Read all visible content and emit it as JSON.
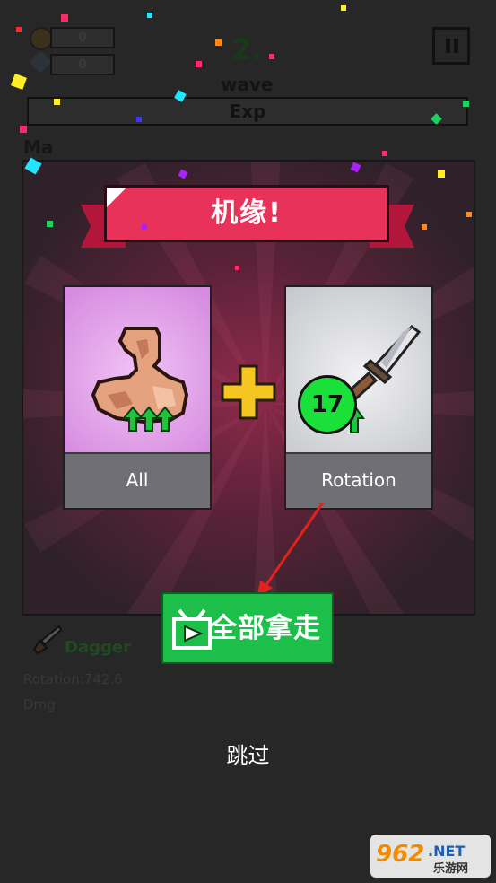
{
  "hud": {
    "coins": "0",
    "gems": "0",
    "wave_number": "2.",
    "wave_label": "wave",
    "exp_label": "Exp",
    "max_label": "Ma"
  },
  "popup": {
    "title": "机缘!",
    "left_card": {
      "label": "All",
      "icon": "muscle-arm-icon"
    },
    "right_card": {
      "label": "Rotation",
      "icon": "dagger-icon",
      "level": "17"
    },
    "take_all_label": "全部拿走",
    "skip_label": "跳过"
  },
  "weapon": {
    "name": "Dagger",
    "stat1": "Rotation:742.6",
    "stat2": "Dmg"
  },
  "watermark": {
    "number": "962",
    "suffix": ".NET",
    "site": "乐游网"
  },
  "colors": {
    "ribbon": "#e8325a",
    "take_all_button": "#1bbf4a",
    "level_badge": "#19e13a",
    "plus": "#f5c520"
  }
}
